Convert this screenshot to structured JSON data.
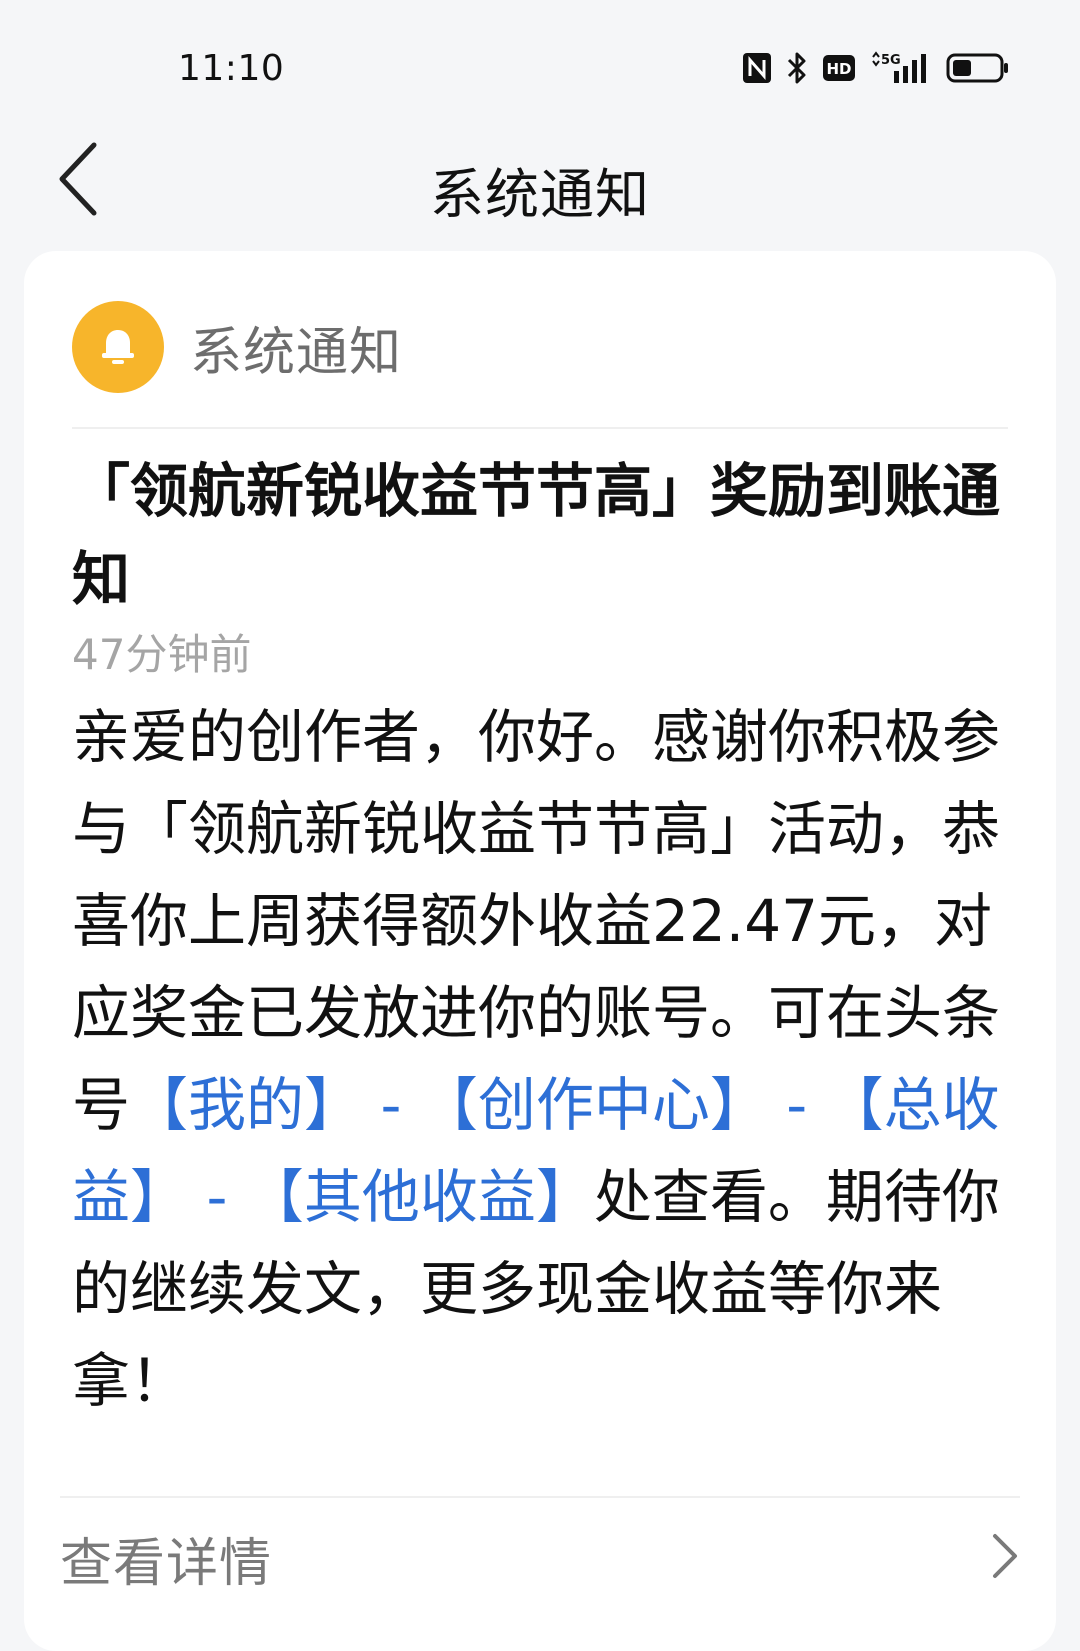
{
  "status_bar": {
    "time": "11:10",
    "network": "5G",
    "hd": "HD"
  },
  "nav": {
    "title": "系统通知"
  },
  "notification": {
    "sender": "系统通知",
    "title": "「领航新锐收益节节高」奖励到账通知",
    "time_ago": "47分钟前",
    "body": {
      "part1": "亲爱的创作者，你好。感谢你积极参与「领航新锐收益节节高」活动，恭喜你上周获得额外收益22.47元，对应奖金已发放进你的账号。可在头条号",
      "link_mine": "【我的】",
      "sep1": " - ",
      "link_creation_center": "【创作中心】",
      "sep2": " - ",
      "link_total_income": "【总收益】",
      "sep3": " - ",
      "link_other_income": "【其他收益】",
      "part2": "处查看。期待你的继续发文，更多现金收益等你来拿！"
    },
    "view_details": "查看详情"
  },
  "colors": {
    "accent_link": "#2d6fd6",
    "avatar_bg": "#f7b52b",
    "page_bg": "#f5f6f8"
  },
  "icons": {
    "back": "chevron-left-icon",
    "avatar": "bell-icon",
    "detail_arrow": "chevron-right-icon"
  }
}
